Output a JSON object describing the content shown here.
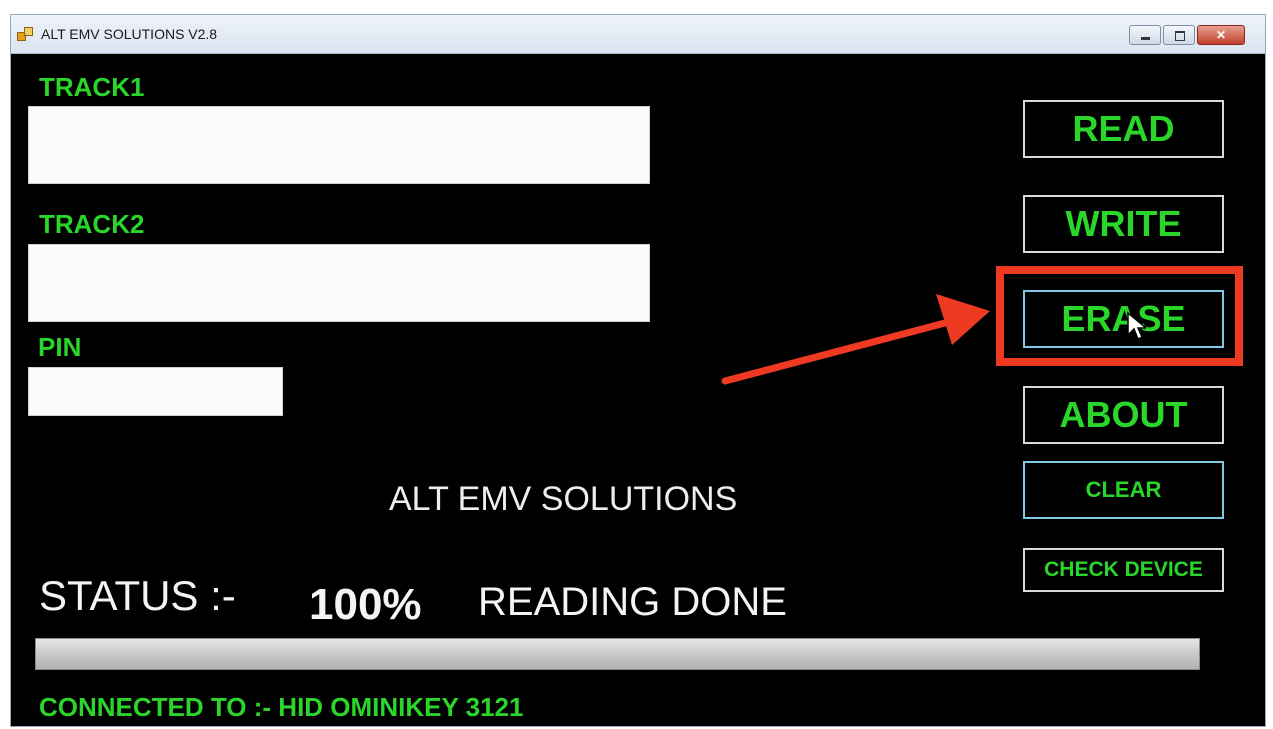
{
  "window": {
    "title": "ALT EMV SOLUTIONS V2.8"
  },
  "fields": {
    "track1": {
      "label": "TRACK1",
      "value": ""
    },
    "track2": {
      "label": "TRACK2",
      "value": ""
    },
    "pin": {
      "label": "PIN",
      "value": ""
    }
  },
  "buttons": {
    "read": "READ",
    "write": "WRITE",
    "erase": "ERASE",
    "about": "ABOUT",
    "clear": "CLEAR",
    "check_device": "CHECK DEVICE"
  },
  "brand": "ALT EMV SOLUTIONS",
  "status": {
    "label": "STATUS :-",
    "percent": "100%",
    "message": "READING DONE",
    "progress_fraction": 1.0
  },
  "connection": "CONNECTED TO :- HID OMINIKEY 3121",
  "colors": {
    "accent_green": "#2bd62b",
    "background": "#000000",
    "annotation_red": "#ef3a23"
  }
}
